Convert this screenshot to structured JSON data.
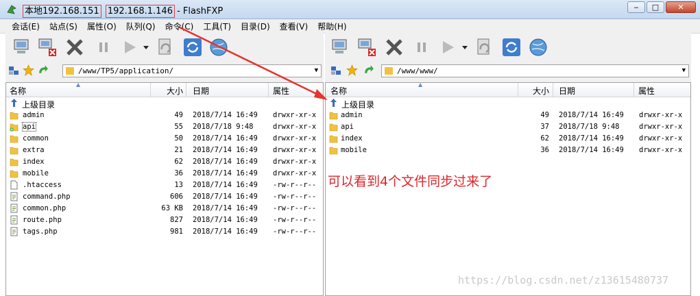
{
  "window": {
    "title_local": "本地192.168.151",
    "title_remote": "192.168.1.146",
    "title_app": " - FlashFXP",
    "min_label": "‒",
    "max_label": "□",
    "close_label": "✕"
  },
  "menu": [
    "会话(E)",
    "站点(S)",
    "属性(O)",
    "队列(Q)",
    "命令(C)",
    "工具(T)",
    "目录(D)",
    "查看(V)",
    "帮助(H)"
  ],
  "left": {
    "path": "/www/TP5/application/",
    "columns": {
      "name": "名称",
      "size": "大小",
      "date": "日期",
      "attr": "属性"
    },
    "parent": "上级目录",
    "rows": [
      {
        "name": "admin",
        "size": "49",
        "date": "2018/7/14 16:49",
        "attr": "drwxr-xr-x",
        "type": "folder"
      },
      {
        "name": "api",
        "size": "55",
        "date": "2018/7/18 9:48",
        "attr": "drwxr-xr-x",
        "type": "folder-new"
      },
      {
        "name": "common",
        "size": "50",
        "date": "2018/7/14 16:49",
        "attr": "drwxr-xr-x",
        "type": "folder"
      },
      {
        "name": "extra",
        "size": "21",
        "date": "2018/7/14 16:49",
        "attr": "drwxr-xr-x",
        "type": "folder"
      },
      {
        "name": "index",
        "size": "62",
        "date": "2018/7/14 16:49",
        "attr": "drwxr-xr-x",
        "type": "folder"
      },
      {
        "name": "mobile",
        "size": "36",
        "date": "2018/7/14 16:49",
        "attr": "drwxr-xr-x",
        "type": "folder"
      },
      {
        "name": ".htaccess",
        "size": "13",
        "date": "2018/7/14 16:49",
        "attr": "-rw-r--r--",
        "type": "file"
      },
      {
        "name": "command.php",
        "size": "606",
        "date": "2018/7/14 16:49",
        "attr": "-rw-r--r--",
        "type": "php"
      },
      {
        "name": "common.php",
        "size": "63 KB",
        "date": "2018/7/14 16:49",
        "attr": "-rw-r--r--",
        "type": "php"
      },
      {
        "name": "route.php",
        "size": "827",
        "date": "2018/7/14 16:49",
        "attr": "-rw-r--r--",
        "type": "php"
      },
      {
        "name": "tags.php",
        "size": "981",
        "date": "2018/7/14 16:49",
        "attr": "-rw-r--r--",
        "type": "php"
      }
    ]
  },
  "right": {
    "path": "/www/www/",
    "columns": {
      "name": "名称",
      "size": "大小",
      "date": "日期",
      "attr": "属性"
    },
    "parent": "上级目录",
    "rows": [
      {
        "name": "admin",
        "size": "49",
        "date": "2018/7/14 16:49",
        "attr": "drwxr-xr-x",
        "type": "folder"
      },
      {
        "name": "api",
        "size": "37",
        "date": "2018/7/18 9:48",
        "attr": "drwxr-xr-x",
        "type": "folder"
      },
      {
        "name": "index",
        "size": "62",
        "date": "2018/7/14 16:49",
        "attr": "drwxr-xr-x",
        "type": "folder"
      },
      {
        "name": "mobile",
        "size": "36",
        "date": "2018/7/14 16:49",
        "attr": "drwxr-xr-x",
        "type": "folder"
      }
    ]
  },
  "annotation": "可以看到4个文件同步过来了",
  "watermark": "https://blog.csdn.net/z13615480737",
  "colors": {
    "accent_red": "#e0242a",
    "folder": "#f1c240"
  }
}
